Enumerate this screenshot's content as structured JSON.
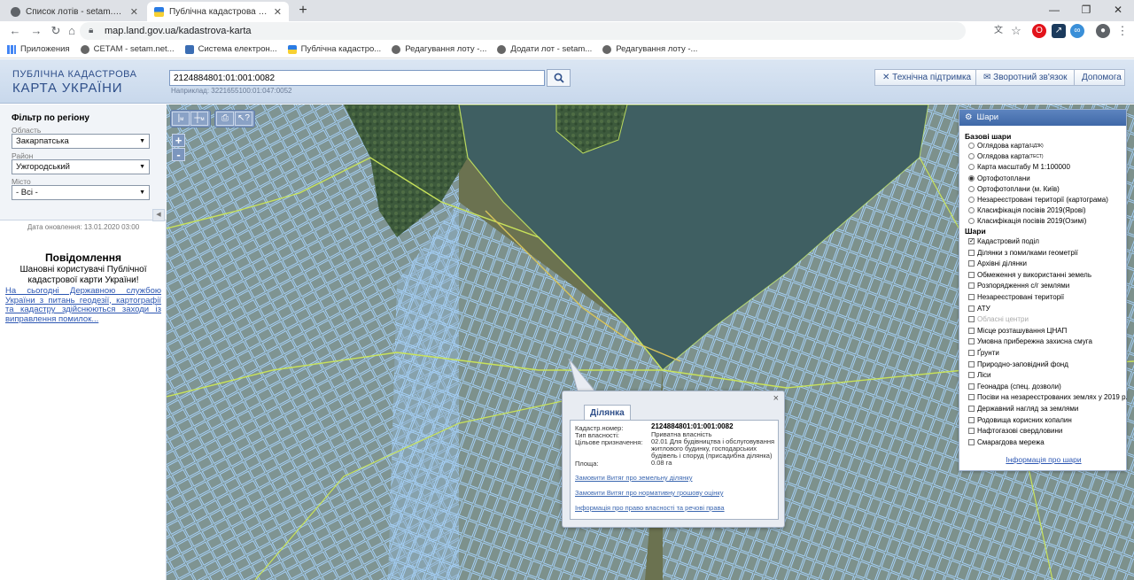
{
  "browser": {
    "tabs": [
      {
        "title": "Список лотів - setam.net.ua"
      },
      {
        "title": "Публічна кадастрова карта Укр"
      }
    ],
    "new_tab": "+",
    "url": "map.land.gov.ua/kadastrova-karta",
    "bookmarks": [
      {
        "label": "Приложения"
      },
      {
        "label": "СЕТАМ - setam.net..."
      },
      {
        "label": "Система електрон..."
      },
      {
        "label": "Публічна кадастро..."
      },
      {
        "label": "Редагування лоту -..."
      },
      {
        "label": "Додати лот - setam..."
      },
      {
        "label": "Редагування лоту -..."
      }
    ]
  },
  "header": {
    "logo_line1": "ПУБЛІЧНА КАДАСТРОВА",
    "logo_line2": "КАРТА УКРАЇНИ",
    "search_value": "2124884801:01:001:0082",
    "search_hint": "Наприклад: 3221655100:01:047:0052",
    "support": "Технічна підтримка",
    "feedback": "Зворотний зв'язок",
    "help": "Допомога"
  },
  "filter": {
    "title": "Фільтр по регіону",
    "oblast_label": "Область",
    "oblast_value": "Закарпатська",
    "rayon_label": "Район",
    "rayon_value": "Ужгородський",
    "city_label": "Місто",
    "city_value": "- Всі -"
  },
  "notice": {
    "updated": "Дата оновлення: 13.01.2020 03:00",
    "title": "Повідомлення",
    "body": "Шановні користувачі Публічної кадастрової карти України!",
    "link": "На сьогодні Державною службою України з питань геодезії, картографії та кадастру здійснюються заходи із виправлення помилок..."
  },
  "map": {
    "zoom_in": "+",
    "zoom_out": "-"
  },
  "layers": {
    "title": "Шари",
    "base_title": "Базові шари",
    "base": [
      {
        "label": "Оглядова карта",
        "sup": "(ЦДЗК)",
        "on": false
      },
      {
        "label": "Оглядова карта",
        "sup": "(ТЕСТ)",
        "on": false
      },
      {
        "label": "Карта масштабу М 1:100000",
        "sup": "",
        "on": false
      },
      {
        "label": "Ортофотоплани",
        "sup": "",
        "on": true
      },
      {
        "label": "Ортофотоплани (м. Київ)",
        "sup": "",
        "on": false
      },
      {
        "label": "Незареєстровані території (картограма)",
        "sup": "",
        "on": false
      },
      {
        "label": "Класифікація посівів 2019(Ярові)",
        "sup": "",
        "on": false
      },
      {
        "label": "Класифікація посівів 2019(Озимі)",
        "sup": "",
        "on": false
      }
    ],
    "layers_title": "Шари",
    "items": [
      {
        "label": "Кадастровий поділ",
        "on": true,
        "dim": false
      },
      {
        "label": "Ділянки з помилками геометрії",
        "on": false,
        "dim": false
      },
      {
        "label": "Архівні ділянки",
        "on": false,
        "dim": false
      },
      {
        "label": "Обмеження у використанні земель",
        "on": false,
        "dim": false
      },
      {
        "label": "Розпорядження с/г землями",
        "on": false,
        "dim": false
      },
      {
        "label": "Незареєстровані території",
        "on": false,
        "dim": false
      },
      {
        "label": "АТУ",
        "on": false,
        "dim": false
      },
      {
        "label": "Обласні центри",
        "on": false,
        "dim": true
      },
      {
        "label": "Місце розташування ЦНАП",
        "on": false,
        "dim": false
      },
      {
        "label": "Умовна прибережна захисна смуга",
        "on": false,
        "dim": false
      },
      {
        "label": "Ґрунти",
        "on": false,
        "dim": false
      },
      {
        "label": "Природно-заповідний фонд",
        "on": false,
        "dim": false
      },
      {
        "label": "Ліси",
        "on": false,
        "dim": false
      },
      {
        "label": "Геонадра (спец. дозволи)",
        "on": false,
        "dim": false
      },
      {
        "label": "Посіви на незареєстрованих землях у 2019 р.",
        "on": false,
        "dim": false
      },
      {
        "label": "Державний нагляд за землями",
        "on": false,
        "dim": false
      },
      {
        "label": "Родовища корисних копалин",
        "on": false,
        "dim": false
      },
      {
        "label": "Нафтогазові свердловини",
        "on": false,
        "dim": false
      },
      {
        "label": "Смарагдова мережа",
        "on": false,
        "dim": false
      }
    ],
    "info_link": "Інформація про шари"
  },
  "popup": {
    "tab": "Ділянка",
    "close": "×",
    "fields": {
      "cadnum_label": "Кадастр.номер:",
      "cadnum": "2124884801:01:001:0082",
      "ownership_label": "Тип власності:",
      "ownership": "Приватна власність",
      "purpose_label": "Цільове призначення:",
      "purpose": "02.01 Для будівництва і обслуговування житлового будинку, господарських будівель і споруд (присадибна ділянка)",
      "area_label": "Площа:",
      "area": "0.08 га"
    },
    "links": [
      "Замовити Витяг про земельну ділянку",
      "Замовити Витяг про нормативну грошову оцінку",
      "Інформація про право власності та речові права"
    ]
  }
}
